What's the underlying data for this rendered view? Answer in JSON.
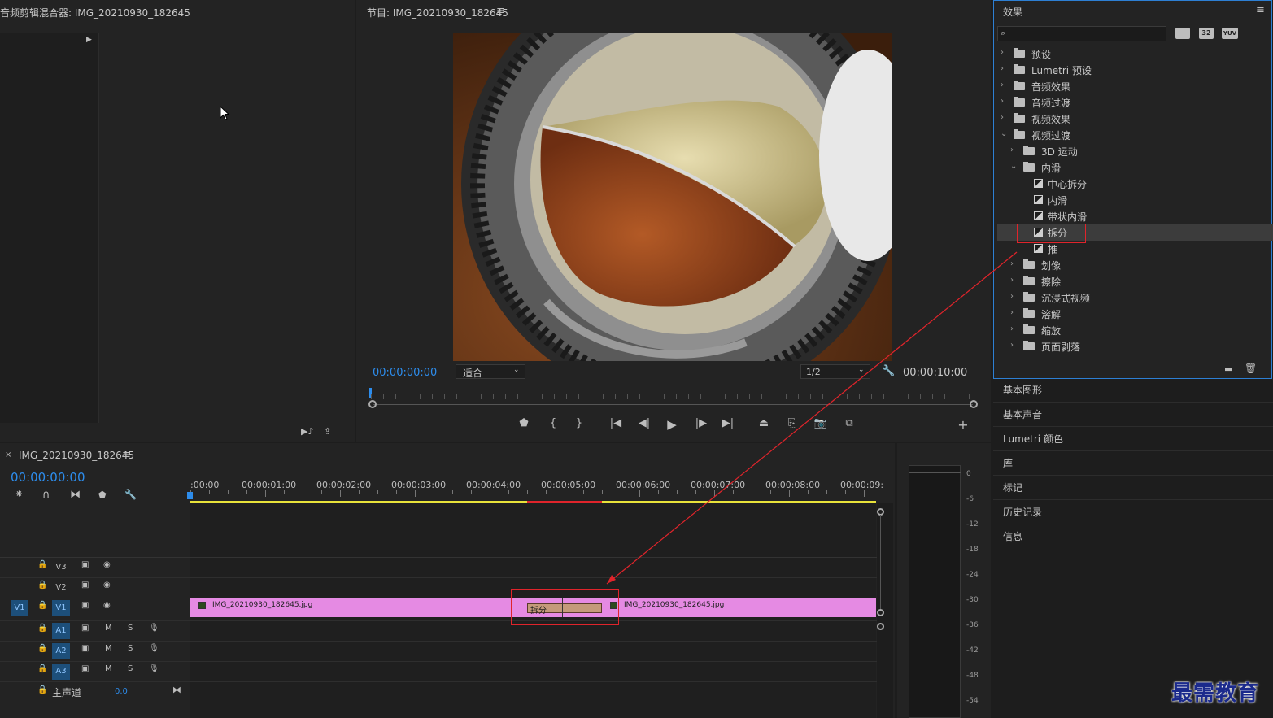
{
  "source_panel": {
    "title": "音频剪辑混合器: IMG_20210930_182645"
  },
  "program_panel": {
    "title": "节目: IMG_20210930_182645",
    "menu_icon": "hamburger-icon",
    "timecode_current": "00:00:00:00",
    "fit_select": "适合",
    "resolution_select": "1/2",
    "timecode_duration": "00:00:10:00"
  },
  "effects_panel": {
    "title": "效果",
    "search_placeholder": "",
    "badges": [
      "32",
      "YUV"
    ],
    "tree": [
      {
        "label": "预设",
        "level": 0,
        "expanded": false,
        "kind": "star-folder"
      },
      {
        "label": "Lumetri 预设",
        "level": 0,
        "expanded": false,
        "kind": "star-folder"
      },
      {
        "label": "音频效果",
        "level": 0,
        "expanded": false,
        "kind": "folder"
      },
      {
        "label": "音频过渡",
        "level": 0,
        "expanded": false,
        "kind": "folder"
      },
      {
        "label": "视频效果",
        "level": 0,
        "expanded": false,
        "kind": "folder"
      },
      {
        "label": "视频过渡",
        "level": 0,
        "expanded": true,
        "kind": "folder"
      },
      {
        "label": "3D 运动",
        "level": 1,
        "expanded": false,
        "kind": "folder"
      },
      {
        "label": "内滑",
        "level": 1,
        "expanded": true,
        "kind": "folder"
      },
      {
        "label": "中心拆分",
        "level": 2,
        "kind": "transition"
      },
      {
        "label": "内滑",
        "level": 2,
        "kind": "transition"
      },
      {
        "label": "带状内滑",
        "level": 2,
        "kind": "transition"
      },
      {
        "label": "拆分",
        "level": 2,
        "kind": "transition",
        "selected": true
      },
      {
        "label": "推",
        "level": 2,
        "kind": "transition"
      },
      {
        "label": "划像",
        "level": 1,
        "expanded": false,
        "kind": "folder"
      },
      {
        "label": "擦除",
        "level": 1,
        "expanded": false,
        "kind": "folder"
      },
      {
        "label": "沉浸式视频",
        "level": 1,
        "expanded": false,
        "kind": "folder"
      },
      {
        "label": "溶解",
        "level": 1,
        "expanded": false,
        "kind": "folder"
      },
      {
        "label": "缩放",
        "level": 1,
        "expanded": false,
        "kind": "folder"
      },
      {
        "label": "页面剥落",
        "level": 1,
        "expanded": false,
        "kind": "folder"
      }
    ]
  },
  "right_panels": [
    "基本图形",
    "基本声音",
    "Lumetri 颜色",
    "库",
    "标记",
    "历史记录",
    "信息"
  ],
  "timeline": {
    "tab_title": "IMG_20210930_182645",
    "timecode": "00:00:00:00",
    "ruler": [
      ":00:00",
      "00:00:01:00",
      "00:00:02:00",
      "00:00:03:00",
      "00:00:04:00",
      "00:00:05:00",
      "00:00:06:00",
      "00:00:07:00",
      "00:00:08:00",
      "00:00:09:"
    ],
    "video_tracks": [
      {
        "name": "V3",
        "source": ""
      },
      {
        "name": "V2",
        "source": ""
      },
      {
        "name": "V1",
        "source": "V1"
      }
    ],
    "audio_tracks": [
      {
        "name": "A1",
        "m": "M",
        "s": "S"
      },
      {
        "name": "A2",
        "m": "M",
        "s": "S"
      },
      {
        "name": "A3",
        "m": "M",
        "s": "S"
      }
    ],
    "master": {
      "label": "主声道",
      "value": "0.0"
    },
    "clip_left": "IMG_20210930_182645.jpg",
    "clip_right": "IMG_20210930_182645.jpg",
    "transition_label": "拆分"
  },
  "meter": {
    "scale": [
      "0",
      "-6",
      "-12",
      "-18",
      "-24",
      "-30",
      "-36",
      "-42",
      "-48",
      "-54"
    ]
  },
  "watermark": "最需教育",
  "colors": {
    "accent_blue": "#2d8ceb",
    "clip_pink": "#e58ae3",
    "highlight_red": "#e0242b",
    "work_area_yellow": "#e8e23a"
  }
}
